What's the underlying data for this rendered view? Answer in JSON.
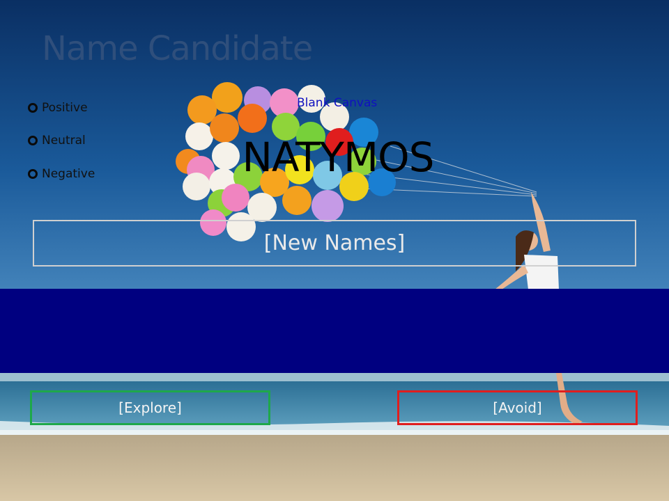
{
  "header": {
    "title": "Name Candidate"
  },
  "sentiment": {
    "options": [
      {
        "label": "Positive"
      },
      {
        "label": "Neutral"
      },
      {
        "label": "Negative"
      }
    ]
  },
  "canvas": {
    "caption": "Blank Canvas",
    "name": "NATYMOS"
  },
  "names_field": {
    "placeholder": "[New Names]"
  },
  "actions": {
    "explore_label": "[Explore]",
    "avoid_label": "[Avoid]"
  },
  "colors": {
    "band": "#000080",
    "explore_border": "#1ea84a",
    "avoid_border": "#e01e1e"
  }
}
